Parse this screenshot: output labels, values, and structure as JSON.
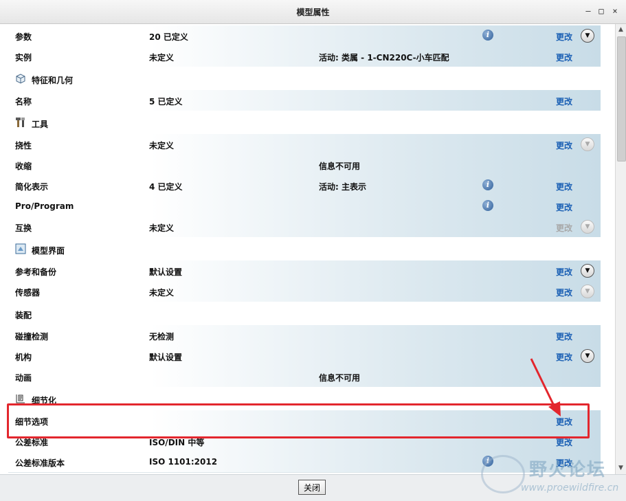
{
  "window": {
    "title": "模型属性",
    "controls": [
      "minimize-icon",
      "maximize-icon",
      "close-icon"
    ]
  },
  "groups": [
    {
      "section": null,
      "rows": [
        {
          "label": "参数",
          "value": "20 已定义",
          "status": "",
          "info": true,
          "change": "更改",
          "change_enabled": true,
          "expand": "on"
        },
        {
          "label": "实例",
          "value": "未定义",
          "status": "活动: 类属 - 1-CN220C-小车匹配",
          "info": false,
          "change": "更改",
          "change_enabled": true,
          "expand": "none"
        }
      ]
    },
    {
      "section": {
        "title": "特征和几何",
        "icon": "feature-geometry-icon"
      },
      "rows": [
        {
          "label": "名称",
          "value": "5 已定义",
          "status": "",
          "info": false,
          "change": "更改",
          "change_enabled": true,
          "expand": "none"
        }
      ]
    },
    {
      "section": {
        "title": "工具",
        "icon": "tools-icon"
      },
      "rows": [
        {
          "label": "挠性",
          "value": "未定义",
          "status": "",
          "info": false,
          "change": "更改",
          "change_enabled": true,
          "expand": "off"
        },
        {
          "label": "收缩",
          "value": "",
          "status": "信息不可用",
          "info": false,
          "change": "",
          "change_enabled": true,
          "expand": "none"
        },
        {
          "label": "简化表示",
          "value": "4 已定义",
          "status": "活动: 主表示",
          "info": true,
          "change": "更改",
          "change_enabled": true,
          "expand": "none"
        },
        {
          "label": "Pro/Program",
          "value": "",
          "status": "",
          "info": true,
          "change": "更改",
          "change_enabled": true,
          "expand": "none"
        },
        {
          "label": "互换",
          "value": "未定义",
          "status": "",
          "info": false,
          "change": "更改",
          "change_enabled": false,
          "expand": "off"
        }
      ]
    },
    {
      "section": {
        "title": "模型界面",
        "icon": "model-interface-icon"
      },
      "rows": [
        {
          "label": "参考和备份",
          "value": "默认设置",
          "status": "",
          "info": false,
          "change": "更改",
          "change_enabled": true,
          "expand": "on"
        },
        {
          "label": "传感器",
          "value": "未定义",
          "status": "",
          "info": false,
          "change": "更改",
          "change_enabled": true,
          "expand": "off"
        }
      ]
    },
    {
      "section": {
        "title": "装配",
        "icon": null
      },
      "rows": [
        {
          "label": "碰撞检测",
          "value": "无检测",
          "status": "",
          "info": false,
          "change": "更改",
          "change_enabled": true,
          "expand": "none"
        },
        {
          "label": "机构",
          "value": "默认设置",
          "status": "",
          "info": false,
          "change": "更改",
          "change_enabled": true,
          "expand": "on"
        },
        {
          "label": "动画",
          "value": "",
          "status": "信息不可用",
          "info": false,
          "change": "",
          "change_enabled": true,
          "expand": "none"
        }
      ]
    },
    {
      "section": {
        "title": "细节化",
        "icon": "detailing-icon"
      },
      "rows": [
        {
          "label": "细节选项",
          "value": "",
          "status": "",
          "info": false,
          "change": "更改",
          "change_enabled": true,
          "expand": "none"
        },
        {
          "label": "公差标准",
          "value": "ISO/DIN 中等",
          "status": "",
          "info": false,
          "change": "更改",
          "change_enabled": true,
          "expand": "none"
        },
        {
          "label": "公差标准版本",
          "value": "ISO 1101:2012",
          "status": "",
          "info": true,
          "change": "更改",
          "change_enabled": true,
          "expand": "none"
        }
      ]
    }
  ],
  "footer": {
    "close_label": "关闭"
  },
  "watermark": {
    "text": "野火论坛",
    "url": "www.proewildfire.cn"
  },
  "annotation": {
    "highlight_color": "#e3262d"
  }
}
